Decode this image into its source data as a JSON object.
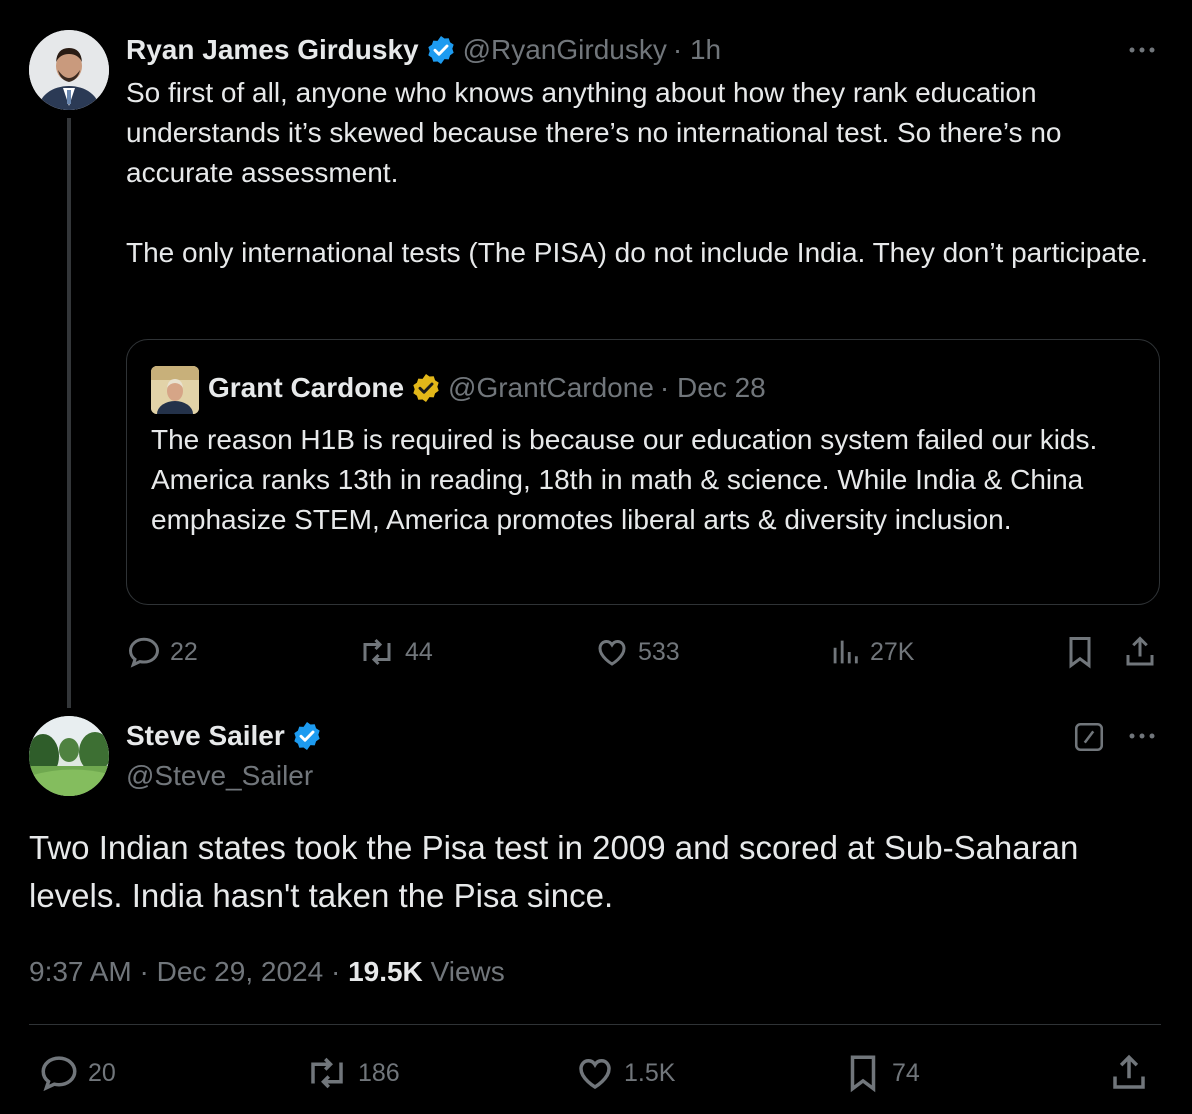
{
  "parent": {
    "author": "Ryan James Girdusky",
    "handle": "@RyanGirdusky",
    "time": "· 1h",
    "paragraphs": [
      "So first of all, anyone who knows anything about how they rank education understands it’s skewed because there’s no international test. So there’s no accurate assessment.",
      "The only international tests (The PISA) do not include India. They don’t participate."
    ],
    "quote": {
      "author": "Grant Cardone",
      "handle": "@GrantCardone",
      "time": "· Dec 28",
      "text": "The reason H1B is required is because our education system failed our kids.  America ranks 13th in reading, 18th in math & science.  While India & China emphasize STEM, America promotes liberal arts & diversity inclusion."
    },
    "actions": {
      "replies": "22",
      "reposts": "44",
      "likes": "533",
      "views": "27K"
    }
  },
  "main": {
    "author": "Steve Sailer",
    "handle": "@Steve_Sailer",
    "text": "Two Indian states took the Pisa test in 2009 and scored at Sub-Saharan levels. India hasn't taken the Pisa since.",
    "time": "9:37 AM · Dec 29, 2024 ·",
    "views_count": "19.5K",
    "views_label": "Views",
    "actions": {
      "replies": "20",
      "reposts": "186",
      "likes": "1.5K",
      "bookmarks": "74"
    }
  },
  "colors": {
    "background": "#000000",
    "text": "#e7e9ea",
    "muted": "#71767b",
    "verified_blue": "#1d9bf0",
    "verified_gold": "#e2b719",
    "border": "#2f3336"
  },
  "icons": [
    "more-icon",
    "verified-icon",
    "reply-icon",
    "repost-icon",
    "like-icon",
    "views-icon",
    "bookmark-icon",
    "share-icon",
    "edit-icon"
  ]
}
